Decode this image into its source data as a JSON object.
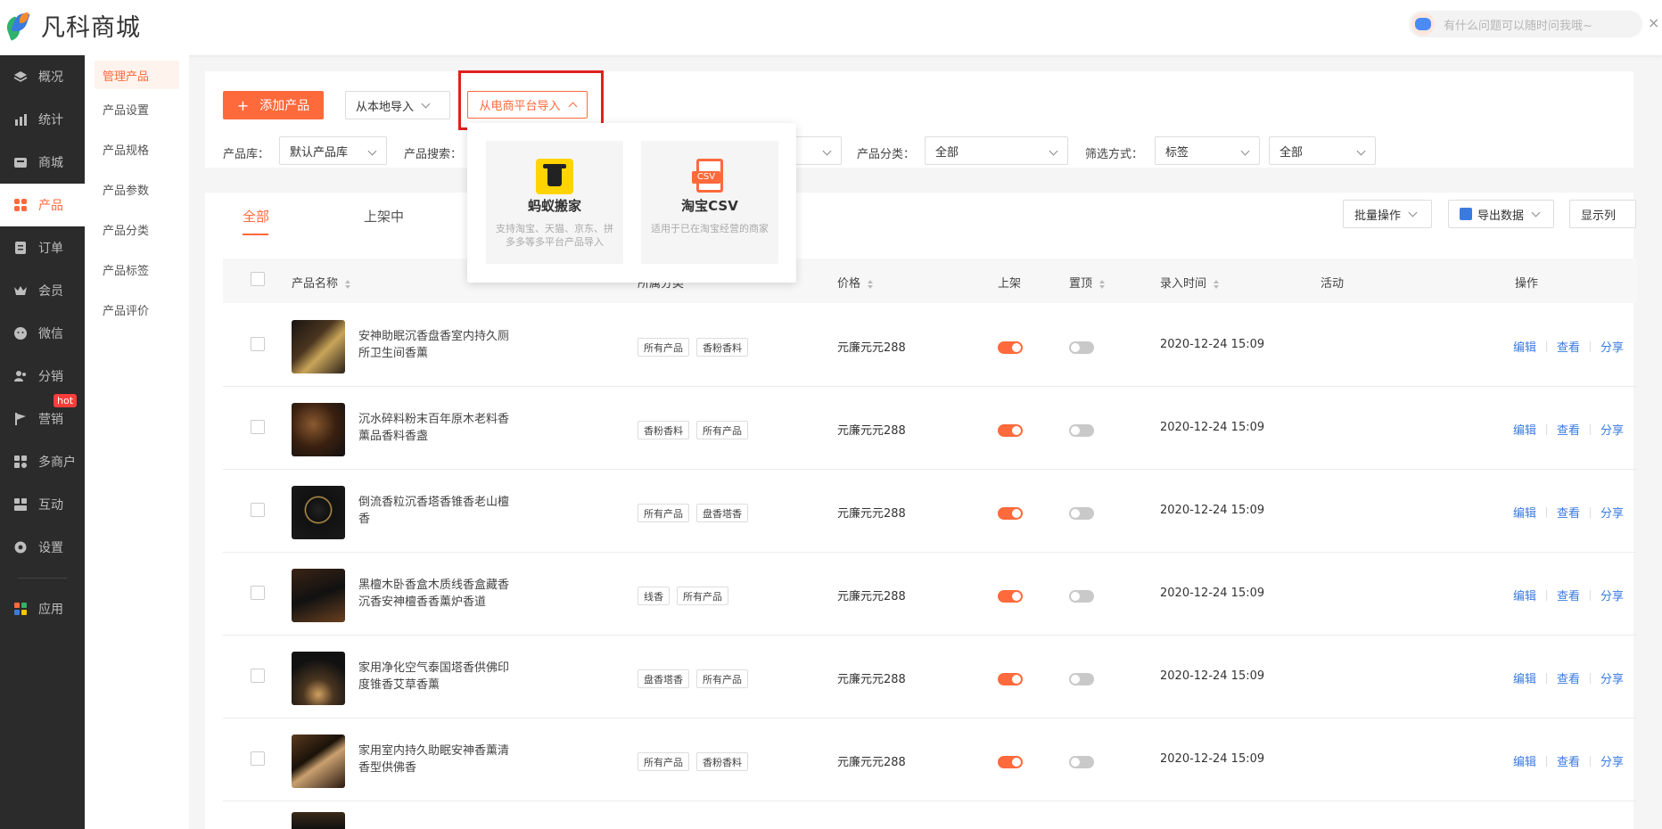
{
  "brand": {
    "name": "凡科商城"
  },
  "help": {
    "placeholder": "有什么问题可以随时问我哦~",
    "close": "×"
  },
  "sidenav": [
    {
      "label": "概况",
      "icon": "layers-icon"
    },
    {
      "label": "统计",
      "icon": "chart-icon"
    },
    {
      "label": "商城",
      "icon": "store-icon"
    },
    {
      "label": "产品",
      "icon": "grid-icon",
      "active": true
    },
    {
      "label": "订单",
      "icon": "order-icon"
    },
    {
      "label": "会员",
      "icon": "crown-icon"
    },
    {
      "label": "微信",
      "icon": "wechat-icon"
    },
    {
      "label": "分销",
      "icon": "users-icon"
    },
    {
      "label": "营销",
      "icon": "flag-icon",
      "badge": "hot"
    },
    {
      "label": "多商户",
      "icon": "multi-shop-icon"
    },
    {
      "label": "互动",
      "icon": "interact-icon"
    },
    {
      "label": "设置",
      "icon": "gear-icon"
    },
    {
      "label": "应用",
      "icon": "apps-icon"
    }
  ],
  "subnav": [
    "管理产品",
    "产品设置",
    "产品规格",
    "产品参数",
    "产品分类",
    "产品标签",
    "产品评价"
  ],
  "toolbar": {
    "add_label": "添加产品",
    "add_plus": "+",
    "local_import": "从本地导入",
    "platform_import": "从电商平台导入"
  },
  "filters": {
    "library_label": "产品库：",
    "library_value": "默认产品库",
    "search_label": "产品搜索：",
    "category_label": "产品分类：",
    "category_value": "全部",
    "mode_label": "筛选方式：",
    "mode_value": "标签",
    "mode_value2": "全部"
  },
  "dropdown": {
    "items": [
      {
        "title": "蚂蚁搬家",
        "desc": "支持淘宝、天猫、京东、拼多多等多平台产品导入",
        "icon": "ant-mover-icon"
      },
      {
        "title": "淘宝CSV",
        "desc": "适用于已在淘宝经营的商家",
        "icon": "csv-file-icon"
      }
    ]
  },
  "tabs": [
    "全部",
    "上架中"
  ],
  "actions": {
    "batch": "批量操作",
    "export": "导出数据",
    "columns": "显示列"
  },
  "table": {
    "headers": {
      "name": "产品名称",
      "category": "所属分类",
      "price": "价格",
      "onsale": "上架",
      "top": "置顶",
      "time": "录入时间",
      "activity": "活动",
      "ops": "操作"
    },
    "ops": [
      "编辑",
      "查看",
      "分享"
    ],
    "rows": [
      {
        "name": "安神助眠沉香盘香室内持久厕所卫生间香薰",
        "tags": [
          "所有产品",
          "香粉香料"
        ],
        "price": "元廉元元288",
        "time": "2020-12-24 15:09",
        "onsale": true,
        "top": false
      },
      {
        "name": "沉水碎料粉末百年原木老料香薰品香料香盏",
        "tags": [
          "香粉香料",
          "所有产品"
        ],
        "price": "元廉元元288",
        "time": "2020-12-24 15:09",
        "onsale": true,
        "top": false
      },
      {
        "name": "倒流香粒沉香塔香锥香老山檀香",
        "tags": [
          "所有产品",
          "盘香塔香"
        ],
        "price": "元廉元元288",
        "time": "2020-12-24 15:09",
        "onsale": true,
        "top": false
      },
      {
        "name": "黑檀木卧香盒木质线香盒藏香沉香安神檀香香薰炉香道",
        "tags": [
          "线香",
          "所有产品"
        ],
        "price": "元廉元元288",
        "time": "2020-12-24 15:09",
        "onsale": true,
        "top": false
      },
      {
        "name": "家用净化空气泰国塔香供佛印度锥香艾草香薰",
        "tags": [
          "盘香塔香",
          "所有产品"
        ],
        "price": "元廉元元288",
        "time": "2020-12-24 15:09",
        "onsale": true,
        "top": false
      },
      {
        "name": "家用室内持久助眠安神香薰清香型供佛香",
        "tags": [
          "所有产品",
          "香粉香料"
        ],
        "price": "元廉元元288",
        "time": "2020-12-24 15:09",
        "onsale": true,
        "top": false
      }
    ]
  },
  "colors": {
    "accent": "#ff6a3c",
    "link": "#3a7be0",
    "nav_bg": "#2b2b2b"
  }
}
